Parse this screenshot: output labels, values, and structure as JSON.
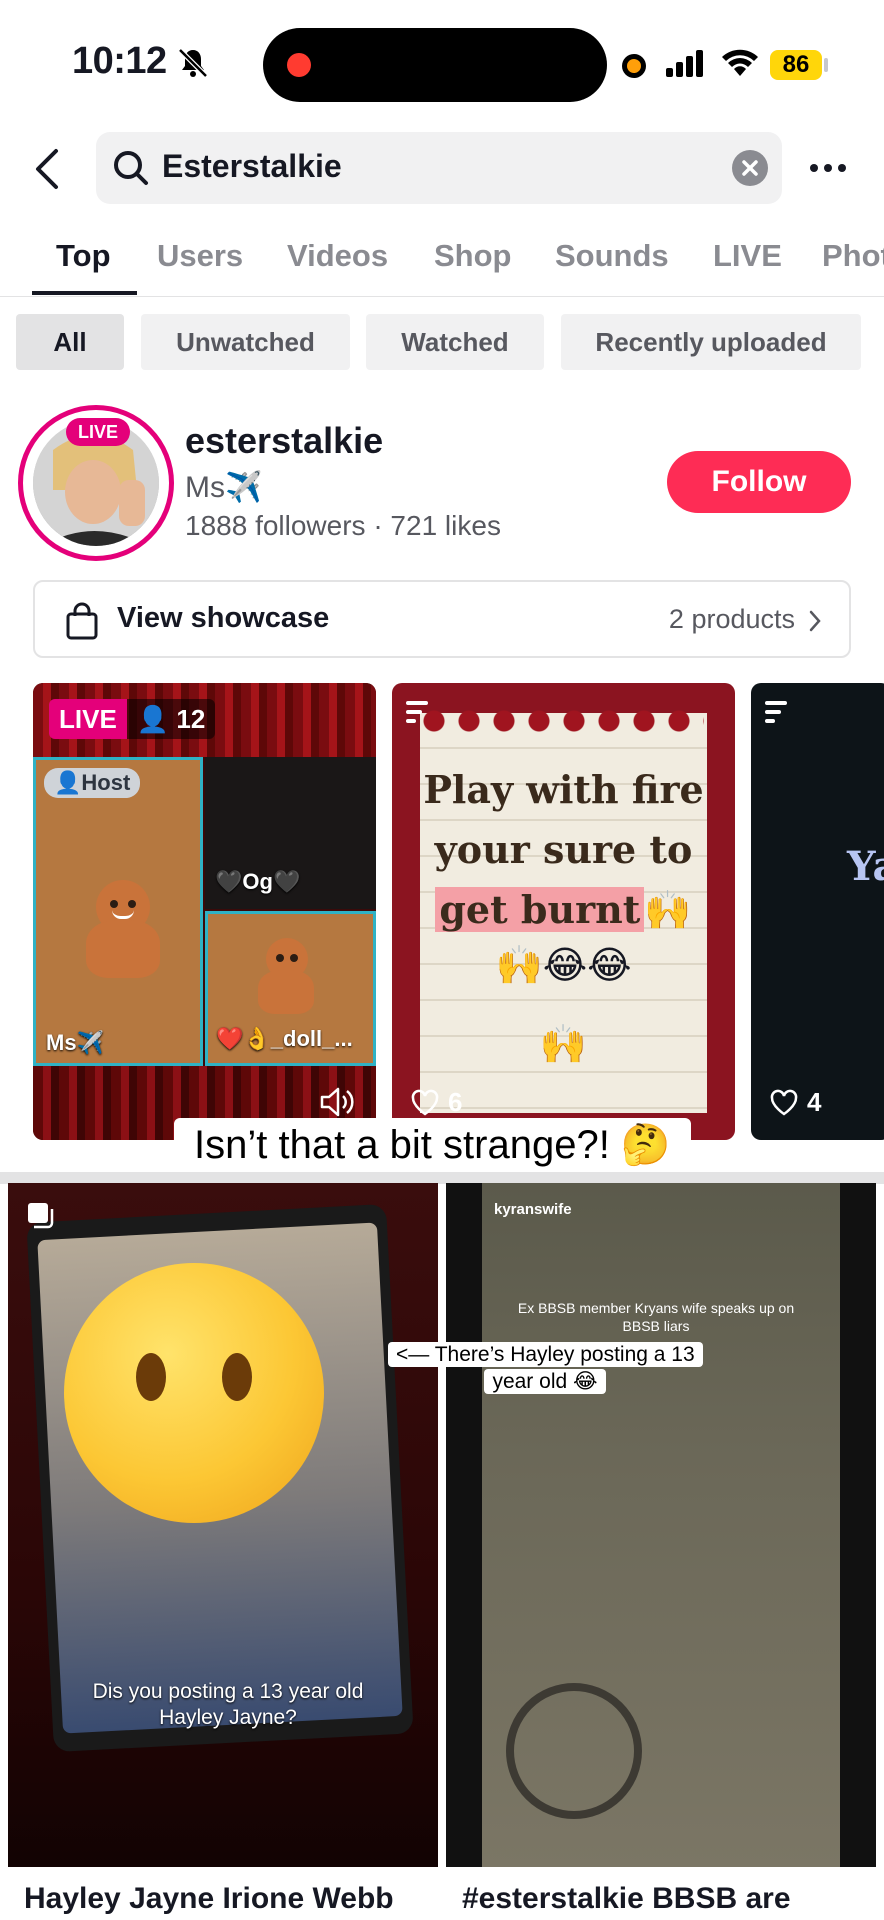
{
  "status_bar": {
    "time": "10:12",
    "battery": "86"
  },
  "search": {
    "query": "Esterstalkie"
  },
  "tabs": [
    "Top",
    "Users",
    "Videos",
    "Shop",
    "Sounds",
    "LIVE",
    "Photos"
  ],
  "filters": [
    "All",
    "Unwatched",
    "Watched",
    "Recently uploaded"
  ],
  "user": {
    "live_tag": "LIVE",
    "username": "esterstalkie",
    "nickname": "Ms✈️",
    "stats": "1888 followers · 721 likes",
    "follow_label": "Follow"
  },
  "showcase": {
    "label": "View showcase",
    "count": "2 products"
  },
  "cards": {
    "live": {
      "badge": "LIVE",
      "viewers": "12",
      "host_tag": "Host",
      "tile_main": "Ms✈️",
      "tile_tr": "🖤Og🖤",
      "tile_br": "❤️👌_doll_..."
    },
    "quote": {
      "line1": "Play with fire",
      "line2": "your sure to",
      "line3_highlight": "get burnt",
      "line3_emoji": "🙌",
      "emoji_row1": "🙌😂😂",
      "emoji_row2": "🙌",
      "likes": "6"
    },
    "third": {
      "text": "Ya",
      "likes": "4"
    }
  },
  "overlay_caption": "Isn’t that a bit strange?! 🤔",
  "videos": [
    {
      "caption": "Dis you posting a 13 year old\nHayley Jayne?",
      "title": "Hayley Jayne Irione Webb"
    },
    {
      "uploader": "kyranswife",
      "screen_text": "Ex BBSB member Kryans wife speaks up on BBSB liars",
      "title": "#esterstalkie BBSB are"
    }
  ],
  "mid_caption": "<— There’s Hayley posting a 13 year old 😂",
  "colors": {
    "accent": "#fe2c55",
    "live": "#e4007a",
    "text": "#161823",
    "muted": "#8a8b91"
  }
}
